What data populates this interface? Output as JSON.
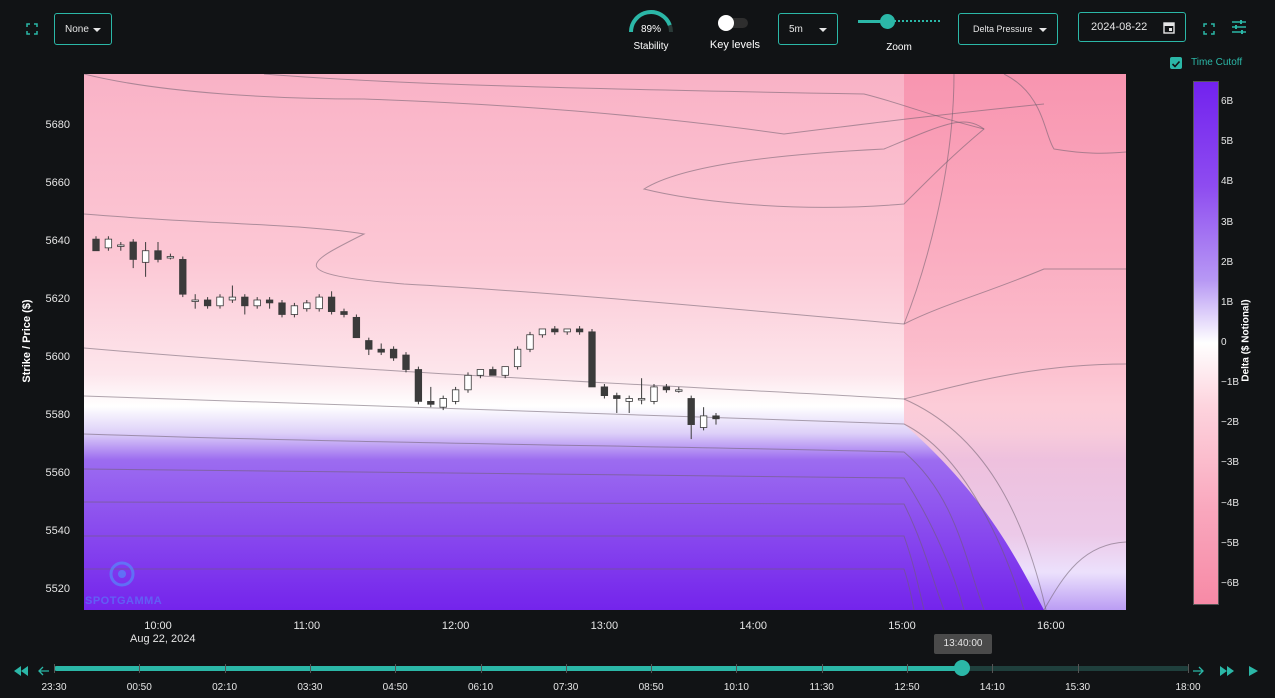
{
  "toolbar": {
    "overlay_select": "None",
    "stability_value": "89%",
    "stability_label": "Stability",
    "stability_fraction": 0.89,
    "key_levels_label": "Key levels",
    "interval_select": "5m",
    "zoom_label": "Zoom",
    "metric_select": "Delta Pressure",
    "date_value": "2024-08-22",
    "time_cutoff_label": "Time Cutoff",
    "accent": "#2bb7a7",
    "icons": [
      "expand-icon",
      "chevron-down-icon",
      "toggle-switch",
      "slider-handle",
      "calendar-icon",
      "settings-sliders-icon"
    ]
  },
  "watermark": "SPOTGAMMA",
  "timeline": {
    "current_time": "13:40:00",
    "ticks": [
      "23:30",
      "00:50",
      "02:10",
      "03:30",
      "04:50",
      "06:10",
      "07:30",
      "08:50",
      "10:10",
      "11:30",
      "12:50",
      "14:10",
      "15:30",
      "18:00"
    ],
    "position_fraction": 0.8,
    "icons": [
      "rewind-icon",
      "arrow-left-icon",
      "arrow-right-icon",
      "fast-forward-icon",
      "play-icon"
    ]
  },
  "chart_data": {
    "type": "heatmap",
    "title": "",
    "ylabel": "Strike / Price ($)",
    "xlabel": "",
    "ylim": [
      5513,
      5698
    ],
    "y_ticks": [
      "5520",
      "5540",
      "5560",
      "5580",
      "5600",
      "5620",
      "5640",
      "5660",
      "5680"
    ],
    "x_ticks": [
      "10:00",
      "11:00",
      "12:00",
      "13:00",
      "14:00",
      "15:00",
      "16:00"
    ],
    "x_date_label": "Aug 22, 2024",
    "colorbar": {
      "label": "Delta ($ Notional)",
      "ticks": [
        "6B",
        "5B",
        "4B",
        "3B",
        "2B",
        "1B",
        "0",
        "−1B",
        "−2B",
        "−3B",
        "−4B",
        "−5B",
        "−6B"
      ],
      "range": [
        -6.5,
        6.5
      ],
      "positive_color": "#7222ee",
      "negative_color": "#f78aa6"
    },
    "candles": {
      "start": "09:35",
      "interval_minutes": 5,
      "ohlc": [
        [
          5641,
          5642,
          5637,
          5637
        ],
        [
          5638,
          5642,
          5637,
          5641
        ],
        [
          5639,
          5640,
          5637,
          5639
        ],
        [
          5640,
          5641,
          5631,
          5634
        ],
        [
          5633,
          5640,
          5628,
          5637
        ],
        [
          5637,
          5640,
          5633,
          5634
        ],
        [
          5635,
          5636,
          5634,
          5635
        ],
        [
          5634,
          5635,
          5621,
          5622
        ],
        [
          5620,
          5622,
          5617,
          5620
        ],
        [
          5620,
          5621,
          5617,
          5618
        ],
        [
          5618,
          5622,
          5617,
          5621
        ],
        [
          5620,
          5625,
          5619,
          5621
        ],
        [
          5621,
          5622,
          5615,
          5618
        ],
        [
          5618,
          5621,
          5617,
          5620
        ],
        [
          5620,
          5621,
          5617,
          5619
        ],
        [
          5619,
          5620,
          5614,
          5615
        ],
        [
          5615,
          5619,
          5614,
          5618
        ],
        [
          5617,
          5620,
          5616,
          5619
        ],
        [
          5617,
          5622,
          5616,
          5621
        ],
        [
          5621,
          5623,
          5615,
          5616
        ],
        [
          5616,
          5617,
          5614,
          5615
        ],
        [
          5614,
          5615,
          5607,
          5607
        ],
        [
          5606,
          5607,
          5601,
          5603
        ],
        [
          5603,
          5605,
          5601,
          5602
        ],
        [
          5603,
          5604,
          5599,
          5600
        ],
        [
          5601,
          5602,
          5595,
          5596
        ],
        [
          5596,
          5597,
          5584,
          5585
        ],
        [
          5585,
          5590,
          5583,
          5584
        ],
        [
          5583,
          5587,
          5582,
          5586
        ],
        [
          5585,
          5590,
          5584,
          5589
        ],
        [
          5589,
          5595,
          5588,
          5594
        ],
        [
          5594,
          5596,
          5593,
          5596
        ],
        [
          5596,
          5597,
          5594,
          5594
        ],
        [
          5594,
          5597,
          5593,
          5597
        ],
        [
          5597,
          5604,
          5596,
          5603
        ],
        [
          5603,
          5609,
          5602,
          5608
        ],
        [
          5608,
          5610,
          5607,
          5610
        ],
        [
          5610,
          5611,
          5608,
          5609
        ],
        [
          5609,
          5610,
          5608,
          5610
        ],
        [
          5610,
          5611,
          5608,
          5609
        ],
        [
          5609,
          5610,
          5590,
          5590
        ],
        [
          5590,
          5591,
          5586,
          5587
        ],
        [
          5587,
          5588,
          5581,
          5586
        ],
        [
          5585,
          5587,
          5581,
          5586
        ],
        [
          5586,
          5593,
          5584,
          5586
        ],
        [
          5585,
          5591,
          5584,
          5590
        ],
        [
          5590,
          5591,
          5588,
          5589
        ],
        [
          5589,
          5590,
          5588,
          5589
        ],
        [
          5586,
          5587,
          5572,
          5577
        ],
        [
          5576,
          5583,
          5575,
          5580
        ],
        [
          5580,
          5581,
          5577,
          5579
        ]
      ]
    }
  }
}
